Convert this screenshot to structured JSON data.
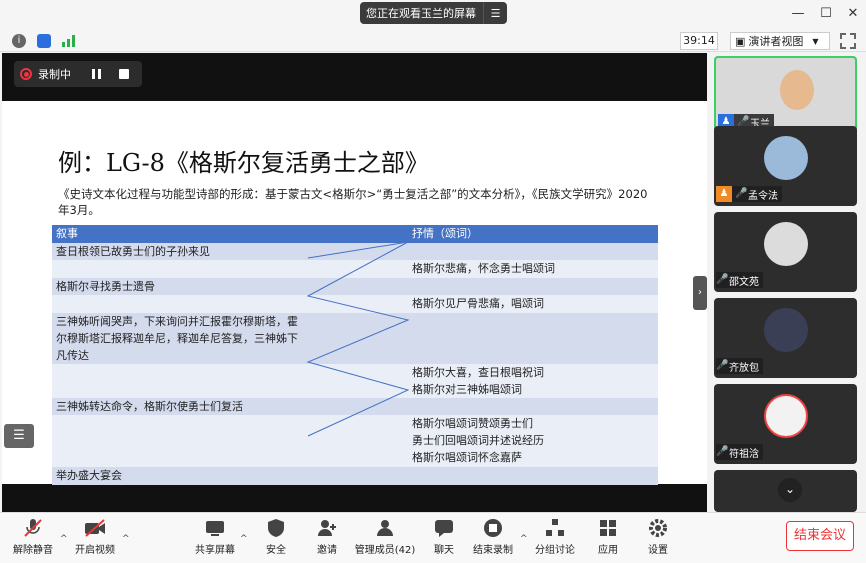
{
  "window": {
    "banner_text": "您正在观看玉兰的屏幕",
    "banner_menu_icon": "menu-icon"
  },
  "toolbar": {
    "timer": "39:14",
    "view_label": "演讲者视图"
  },
  "recording": {
    "label": "录制中"
  },
  "slide": {
    "title": "例：LG-8《格斯尔复活勇士之部》",
    "citation": "《史诗文本化过程与功能型诗部的形成：基于蒙古文<格斯尔>“勇士复活之部”的文本分析》，《民族文学研究》2020年3月。",
    "table": {
      "headers": [
        "叙事",
        "",
        "抒情（颂词）"
      ],
      "rows": [
        [
          "查日根领已故勇士们的子孙来见",
          "",
          ""
        ],
        [
          "",
          "",
          "格斯尔悲痛，怀念勇士唱颂词"
        ],
        [
          "格斯尔寻找勇士遗骨",
          "",
          ""
        ],
        [
          "",
          "",
          "格斯尔见尸骨悲痛，唱颂词"
        ],
        [
          "三神姊听闻哭声，下来询问并汇报霍尔穆斯塔，霍尔穆斯塔汇报释迦牟尼，释迦牟尼答复，三神姊下凡传达",
          "",
          ""
        ],
        [
          "",
          "",
          "格斯尔大喜，查日根唱祝词\n格斯尔对三神姊唱颂词"
        ],
        [
          "三神姊转达命令，格斯尔使勇士们复活",
          "",
          ""
        ],
        [
          "",
          "",
          "格斯尔唱颂词赞颂勇士们\n勇士们回唱颂词并述说经历\n格斯尔唱颂词怀念嘉萨"
        ],
        [
          "举办盛大宴会",
          "",
          ""
        ]
      ]
    }
  },
  "participants": [
    {
      "name": "玉兰",
      "host": true
    },
    {
      "name": "孟令法",
      "host": true
    },
    {
      "name": "邵文苑",
      "host": false
    },
    {
      "name": "齐放包",
      "host": false
    },
    {
      "name": "符祖浛",
      "host": false
    }
  ],
  "bottom": {
    "mute": "解除静音",
    "video": "开启视频",
    "share": "共享屏幕",
    "security": "安全",
    "invite": "邀请",
    "members": "管理成员(42)",
    "chat": "聊天",
    "stop_record": "结束录制",
    "breakout": "分组讨论",
    "apps": "应用",
    "settings": "设置",
    "end": "结束会议"
  },
  "colors": {
    "table_header": "#4472c4",
    "row_dark": "#d4dbed",
    "row_light": "#eaeef7",
    "end_red": "#e33"
  }
}
